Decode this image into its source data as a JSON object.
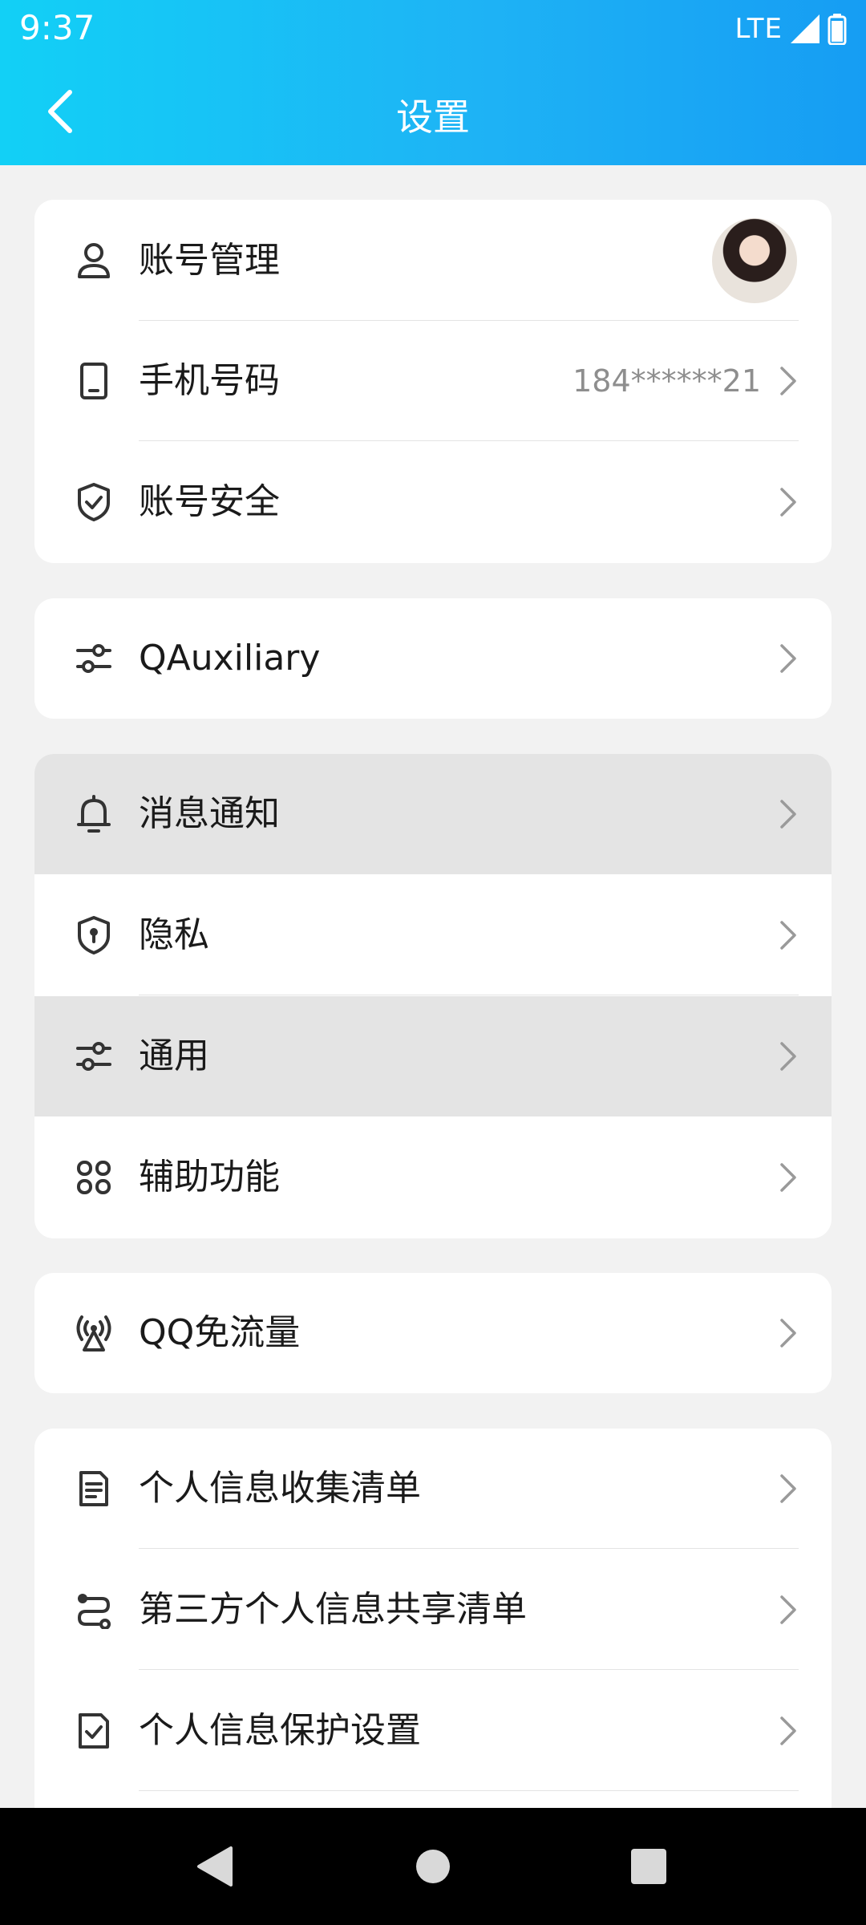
{
  "status_bar": {
    "time": "9:37",
    "network": "LTE"
  },
  "header": {
    "title": "设置"
  },
  "groups": [
    {
      "items": [
        {
          "label": "账号管理",
          "icon": "person-icon"
        },
        {
          "label": "手机号码",
          "value": "184******21",
          "icon": "phone-icon"
        },
        {
          "label": "账号安全",
          "icon": "shield-check-icon"
        }
      ]
    },
    {
      "items": [
        {
          "label": "QAuxiliary",
          "icon": "sliders-icon"
        }
      ]
    },
    {
      "items": [
        {
          "label": "消息通知",
          "icon": "bell-icon"
        },
        {
          "label": "隐私",
          "icon": "shield-lock-icon"
        },
        {
          "label": "通用",
          "icon": "sliders-icon"
        },
        {
          "label": "辅助功能",
          "icon": "command-icon"
        }
      ]
    },
    {
      "items": [
        {
          "label": "QQ免流量",
          "icon": "signal-tower-icon"
        }
      ]
    },
    {
      "items": [
        {
          "label": "个人信息收集清单",
          "icon": "document-icon"
        },
        {
          "label": "第三方个人信息共享清单",
          "icon": "share-route-icon"
        },
        {
          "label": "个人信息保护设置",
          "icon": "checkbox-doc-icon"
        }
      ]
    }
  ],
  "colors": {
    "header_start": "#12d0f6",
    "header_end": "#169df3",
    "background": "#f2f2f2",
    "pressed_row": "#e4e4e4"
  }
}
